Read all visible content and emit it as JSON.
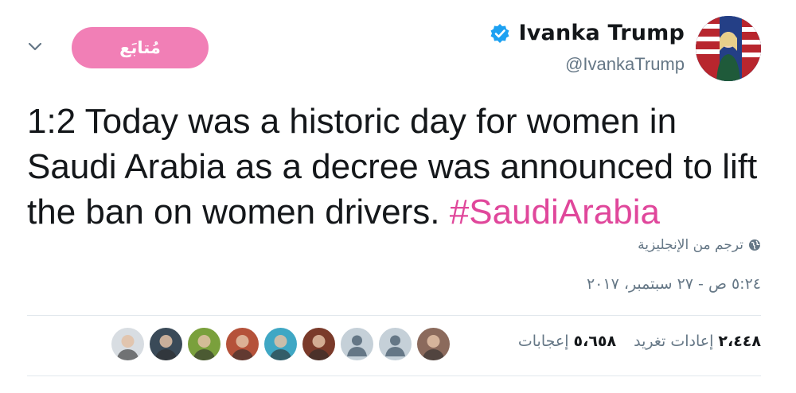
{
  "header": {
    "display_name": "Ivanka Trump",
    "handle": "@IvankaTrump",
    "follow_label": "مُتابَع",
    "verified_icon": "verified-badge-icon",
    "avatar_icon": "profile-photo",
    "menu_icon": "chevron-down-icon"
  },
  "tweet": {
    "text": "1:2 Today was a historic day for women in Saudi Arabia as a decree was announced to lift the ban on women drivers.",
    "hashtag": "#SaudiArabia",
    "translate_label": "ترجم من الإنجليزية",
    "timestamp": "٥:٢٤ ص - ٢٧ سبتمبر، ٢٠١٧"
  },
  "stats": {
    "retweets_count": "٢،٤٤٨",
    "retweets_label": "إعادات تغريد",
    "likes_count": "٥،٦٥٨",
    "likes_label": "إعجابات"
  },
  "likers": [
    {
      "name": "liker-avatar-1",
      "kind": "photo",
      "color": "#8b6a5c"
    },
    {
      "name": "liker-avatar-2",
      "kind": "default",
      "color": "#c5d0d8"
    },
    {
      "name": "liker-avatar-3",
      "kind": "default",
      "color": "#c5d0d8"
    },
    {
      "name": "liker-avatar-4",
      "kind": "photo",
      "color": "#7a3a2a"
    },
    {
      "name": "liker-avatar-5",
      "kind": "photo",
      "color": "#3fa7c4"
    },
    {
      "name": "liker-avatar-6",
      "kind": "photo",
      "color": "#b5523a"
    },
    {
      "name": "liker-avatar-7",
      "kind": "photo",
      "color": "#7aa03c"
    },
    {
      "name": "liker-avatar-8",
      "kind": "photo",
      "color": "#3a4a58"
    },
    {
      "name": "liker-avatar-9",
      "kind": "photo",
      "color": "#d8dde2"
    }
  ],
  "colors": {
    "accent_pink": "#f17fb6",
    "hashtag_pink": "#e0479b",
    "secondary_text": "#657786",
    "verified_blue": "#1da1f2"
  }
}
